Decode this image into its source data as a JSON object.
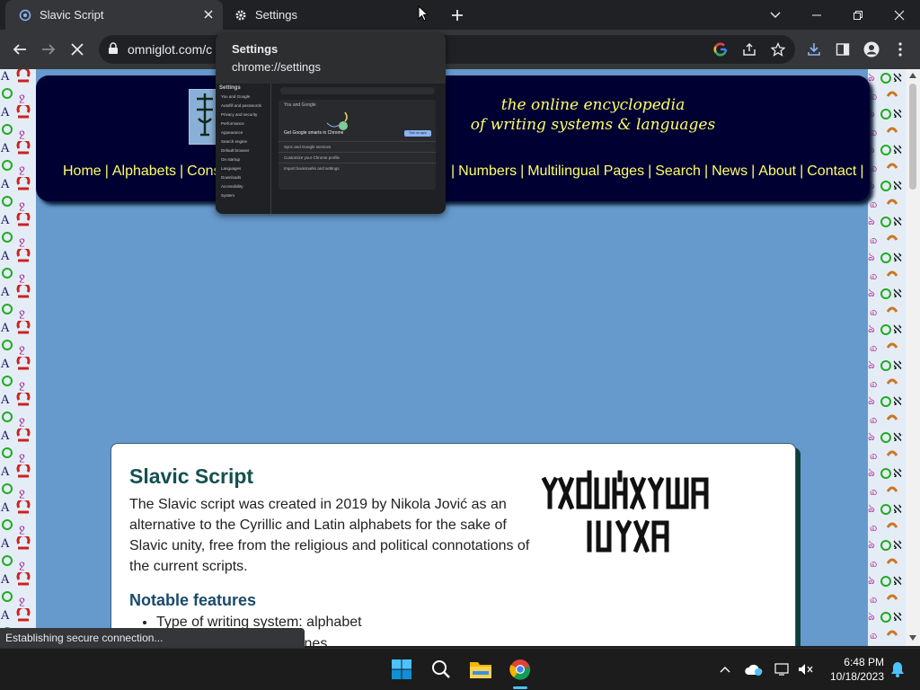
{
  "browser": {
    "tabs": [
      {
        "title": "Slavic Script",
        "active": true
      },
      {
        "title": "Settings",
        "active": false
      }
    ],
    "url": "omniglot.com/c",
    "status_text": "Establishing secure connection..."
  },
  "hover_card": {
    "title": "Settings",
    "url": "chrome://settings",
    "preview": {
      "header": "Settings",
      "search_placeholder": "Search settings",
      "section_heading": "You and Google",
      "promo_title": "Get Google smarts in Chrome",
      "promo_button": "Turn on sync",
      "sidebar_items": [
        "You and Google",
        "Autofill and passwords",
        "Privacy and security",
        "Performance",
        "Appearance",
        "Search engine",
        "Default browser",
        "On startup",
        "Languages",
        "Downloads",
        "Accessibility",
        "System"
      ],
      "panel_lines": [
        "Sync and Google services",
        "Customize your Chrome profile",
        "Import bookmarks and settings"
      ]
    }
  },
  "site": {
    "tagline_line1": "the online encyclopedia",
    "tagline_line2": "of writing systems & languages",
    "nav": [
      "Home",
      "Alphabets",
      "Const",
      "Numbers",
      "Multilingual Pages",
      "Search",
      "News",
      "About",
      "Contact"
    ]
  },
  "article": {
    "title": "Slavic Script",
    "intro": "The Slavic script was created in 2019 by Nikola Jović as an alternative to the Cyrillic and Latin alphabets for the sake of Slavic unity, free from the religious and political connotations of the current scripts.",
    "features_heading": "Notable features",
    "features": [
      "Type of writing system: alphabet",
      "...to right in horizontal lines"
    ]
  },
  "taskbar": {
    "time": "6:48 PM",
    "date": "10/18/2023"
  },
  "colors": {
    "page_bg": "#6699cc",
    "header_bg": "#000033",
    "nav_text": "#ffff66",
    "title_color": "#145050"
  }
}
